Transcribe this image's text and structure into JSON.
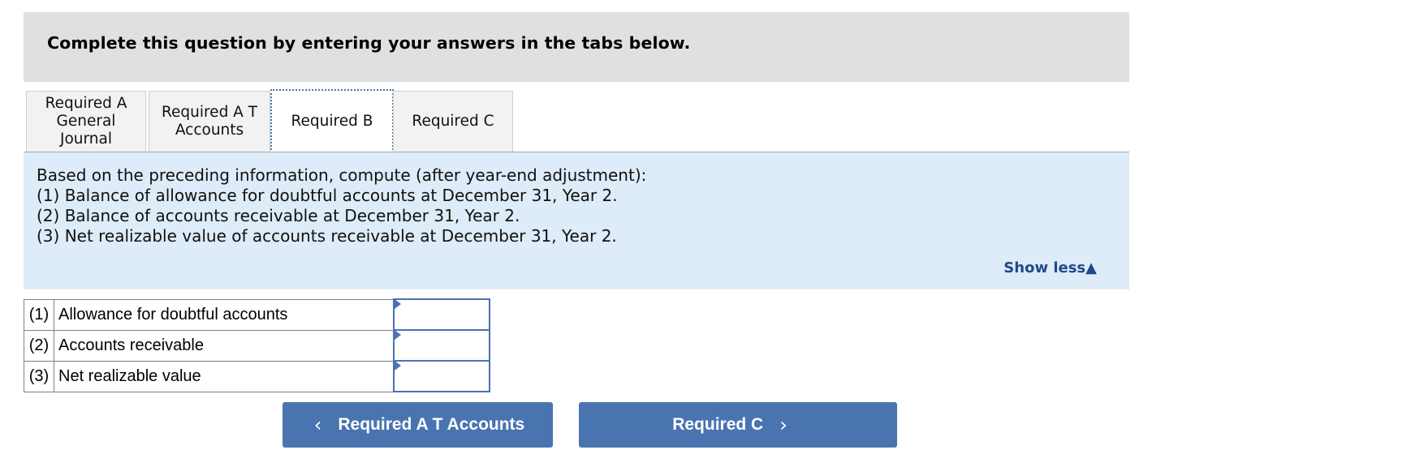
{
  "header": {
    "title": "Complete this question by entering your answers in the tabs below."
  },
  "tabs": [
    {
      "label": "Required A General Journal",
      "lines": [
        "Required A",
        "General",
        "Journal"
      ],
      "active": false
    },
    {
      "label": "Required A T Accounts",
      "lines": [
        "Required A T",
        "Accounts"
      ],
      "active": false
    },
    {
      "label": "Required B",
      "lines": [
        "Required B"
      ],
      "active": true
    },
    {
      "label": "Required C",
      "lines": [
        "Required C"
      ],
      "active": false
    }
  ],
  "panel": {
    "lines": [
      "Based on the preceding information, compute (after year-end adjustment):",
      "(1) Balance of allowance for doubtful accounts at December 31, Year 2.",
      "(2) Balance of accounts receivable at December 31, Year 2.",
      "(3) Net realizable value of accounts receivable at December 31, Year 2."
    ],
    "show_less_label": "Show less",
    "show_less_icon": "triangle-up-icon"
  },
  "answer_table": {
    "rows": [
      {
        "num": "(1)",
        "label": "Allowance for doubtful accounts",
        "value": ""
      },
      {
        "num": "(2)",
        "label": "Accounts receivable",
        "value": ""
      },
      {
        "num": "(3)",
        "label": "Net realizable value",
        "value": ""
      }
    ]
  },
  "nav": {
    "prev_label": "Required A T Accounts",
    "prev_icon": "chevron-left-icon",
    "next_label": "Required C",
    "next_icon": "chevron-right-icon"
  },
  "colors": {
    "accent": "#4a74b0",
    "panel_bg": "#deebf8",
    "header_bg": "#e0e0e0",
    "link": "#1f4a8a"
  }
}
